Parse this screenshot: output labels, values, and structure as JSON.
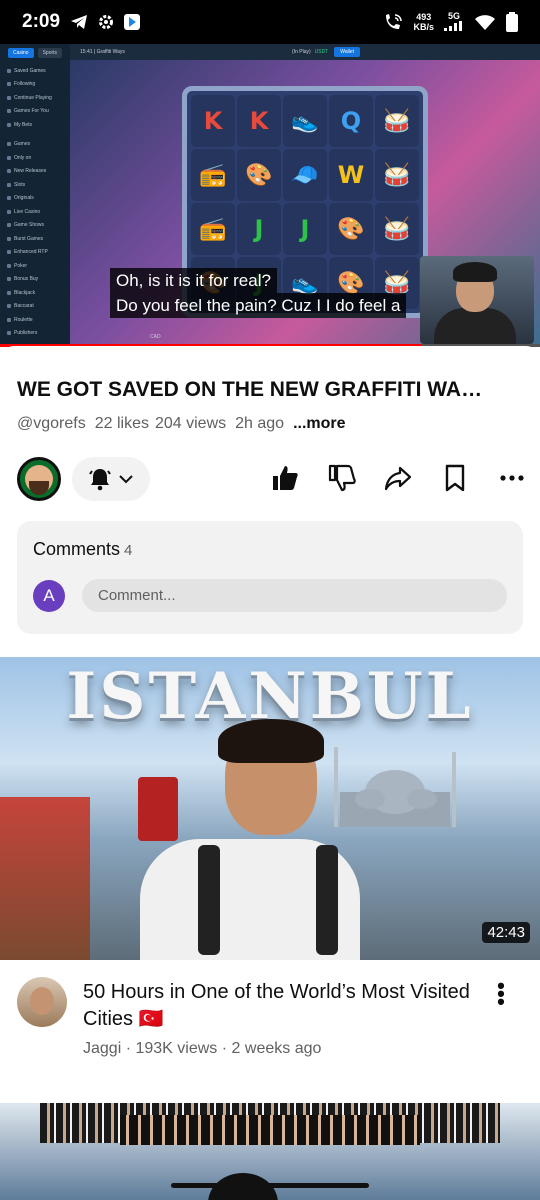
{
  "status_bar": {
    "time": "2:09",
    "net_speed_value": "493",
    "net_speed_unit": "KB/s",
    "network_type": "5G",
    "left_icons": [
      "telegram-icon",
      "gear-icon",
      "play-store-icon"
    ],
    "right_icons": [
      "wifi-call-icon",
      "signal-icon",
      "wifi-icon",
      "battery-icon"
    ]
  },
  "player": {
    "casino_sidebar": {
      "tabs": [
        "Casino",
        "Sports"
      ],
      "items": [
        "Saved Games",
        "Following",
        "Continue Playing",
        "Games For You",
        "My Bets",
        "Games",
        "Only on",
        "New Releases",
        "Slots",
        "Originals",
        "Live Casino",
        "Game Shows",
        "Burst Games",
        "Enhanced RTP",
        "Poker",
        "Bonus Buy",
        "Blackjack",
        "Baccarat",
        "Roulette",
        "Publishers"
      ]
    },
    "casino_top": {
      "breadcrumb": "15:41 | Graffiti Ways",
      "balance_label": "(In Play)",
      "currency": "USDT",
      "wallet_button": "Wallet",
      "bottom_currency": "CAD"
    },
    "reels": [
      [
        "K",
        "K",
        "👟",
        "Q",
        "🥁"
      ],
      [
        "📻",
        "🎨",
        "🧢",
        "W",
        "🥁"
      ],
      [
        "📻",
        "J",
        "J",
        "🎨",
        "🥁"
      ],
      [
        "🎨",
        "J",
        "👟",
        "🎨",
        "🥁"
      ]
    ],
    "captions": [
      "Oh, is it is it for real?",
      "Do you feel the pain? Cuz I I do feel a"
    ],
    "progress_fraction": 0.78,
    "accent_color": "#ff0000"
  },
  "video": {
    "title": "WE GOT SAVED ON THE NEW GRAFFITI WA…",
    "channel": "@vgorefs",
    "likes": "22 likes",
    "views": "204 views",
    "age": "2h ago",
    "more": "...more"
  },
  "actions": {
    "icons": [
      "channel-avatar",
      "bell-icon",
      "chevron-down-icon",
      "like-icon",
      "dislike-icon",
      "share-icon",
      "save-icon",
      "more-icon"
    ]
  },
  "comments": {
    "label": "Comments",
    "count": "4",
    "avatar_letter": "A",
    "placeholder": "Comment..."
  },
  "recommendation_1": {
    "thumb_text": "ISTANBUL",
    "duration": "42:43",
    "title": "50 Hours in One of the World’s Most Visited Cities 🇹🇷",
    "channel": "Jaggi",
    "views": "193K views",
    "age": "2 weeks ago",
    "separator": "·"
  }
}
